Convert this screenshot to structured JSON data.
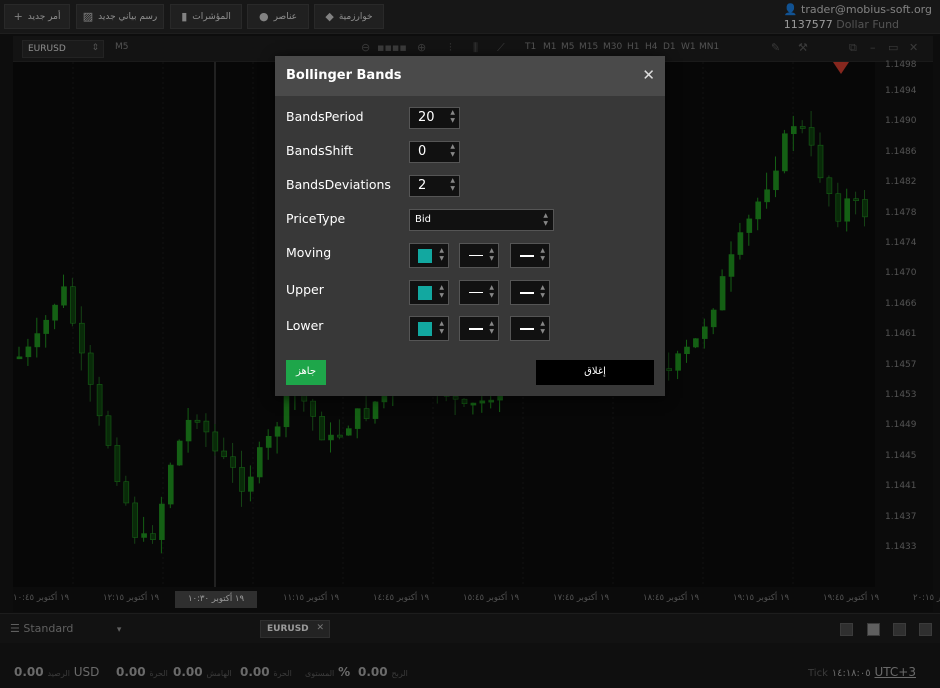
{
  "toolbar": {
    "new_order": "أمر جديد",
    "new_drawing": "رسم بياني جديد",
    "indicators": "المؤشرات",
    "templates": "عناصر",
    "algorithms": "خوارزمية"
  },
  "account": {
    "user": "trader@mobius-soft.org",
    "number": "1137577",
    "fund": "Dollar Fund"
  },
  "chart": {
    "symbol": "EURUSD",
    "period": "M5",
    "timeframes": [
      "T1",
      "M1",
      "M5",
      "M15",
      "M30",
      "H1",
      "H4",
      "D1",
      "W1",
      "MN1"
    ],
    "price_labels": [
      "1.1498",
      "1.1494",
      "1.1490",
      "1.1486",
      "1.1482",
      "1.1478",
      "1.1474",
      "1.1470",
      "1.1466",
      "1.1461",
      "1.1457",
      "1.1453",
      "1.1449",
      "1.1445",
      "1.1441",
      "1.1437",
      "1.1433"
    ],
    "time_labels": [
      "١٩ أكتوبر ١٠:٤٥",
      "١٩ أكتوبر ١٢:١٥",
      "١٩ أكتوبر ١٠:٣٠",
      "١٩ أكتوبر ١١:١٥",
      "١٩ أكتوبر ١٤:٤٥",
      "١٩ أكتوبر ١٥:٤٥",
      "١٩ أكتوبر ١٧:٤٥",
      "١٩ أكتوبر ١٨:٤٥",
      "١٩ أكتوبر ١٩:١٥",
      "١٩ أكتوبر ١٩:٤٥",
      "١٩ أكتوبر ٢٠:١٥"
    ],
    "cursor_time": "١٩ أكتوبر ١٠:٣٠",
    "colors": {
      "bull": "#1e8a1e",
      "bear": "#0d3d0d",
      "accent": "#12a8a0"
    }
  },
  "dialog": {
    "title": "Bollinger Bands",
    "fields": {
      "bands_period": {
        "label": "BandsPeriod",
        "value": "20"
      },
      "bands_shift": {
        "label": "BandsShift",
        "value": "0"
      },
      "bands_deviations": {
        "label": "BandsDeviations",
        "value": "2"
      },
      "price_type": {
        "label": "PriceType",
        "value": "Bid"
      },
      "moving": {
        "label": "Moving"
      },
      "upper": {
        "label": "Upper"
      },
      "lower": {
        "label": "Lower"
      }
    },
    "ok_label": "جاهز",
    "close_label": "إغلاق"
  },
  "bottom": {
    "workspace": "Standard",
    "symbol_tab": "EURUSD"
  },
  "status": {
    "balance": "0.00",
    "balance_label": "الرصيد",
    "currency": "USD",
    "equity": "0.00",
    "equity_label": "الحرة",
    "margin": "0.00",
    "margin_label": "الهامش",
    "free_margin": "0.00",
    "free_margin_label": "الحرة",
    "margin_level_label": "المستوى",
    "margin_level": "%",
    "profit_label": "الربح",
    "profit": "0.00",
    "tick_label": "Tick",
    "tick_value": "١٤:١٨:٠٥",
    "timezone": "UTC+3"
  }
}
